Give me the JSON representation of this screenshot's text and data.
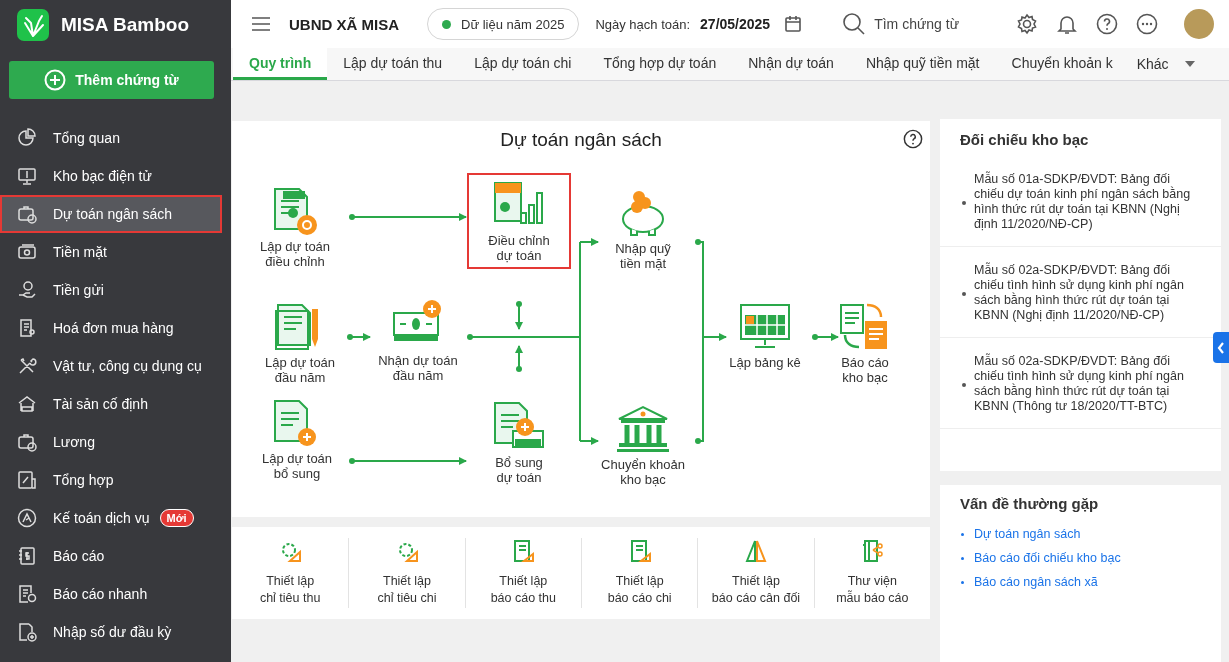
{
  "app": {
    "name": "MISA Bamboo"
  },
  "add_button": {
    "label": "Thêm chứng từ"
  },
  "sidebar": {
    "items": [
      {
        "label": "Tổng quan",
        "selected": false,
        "highlighted": false
      },
      {
        "label": "Kho bạc điện tử",
        "selected": false,
        "highlighted": false
      },
      {
        "label": "Dự toán ngân sách",
        "selected": true,
        "highlighted": true
      },
      {
        "label": "Tiền mặt",
        "selected": false,
        "highlighted": false
      },
      {
        "label": "Tiền gửi",
        "selected": false,
        "highlighted": false
      },
      {
        "label": "Hoá đơn mua hàng",
        "selected": false,
        "highlighted": false
      },
      {
        "label": "Vật tư, công cụ dụng cụ",
        "selected": false,
        "highlighted": false
      },
      {
        "label": "Tài sản cố định",
        "selected": false,
        "highlighted": false
      },
      {
        "label": "Lương",
        "selected": false,
        "highlighted": false
      },
      {
        "label": "Tổng hợp",
        "selected": false,
        "highlighted": false
      },
      {
        "label": "Kế toán dịch vụ",
        "selected": false,
        "highlighted": false,
        "badge": "Mới"
      },
      {
        "label": "Báo cáo",
        "selected": false,
        "highlighted": false
      },
      {
        "label": "Báo cáo nhanh",
        "selected": false,
        "highlighted": false
      },
      {
        "label": "Nhập số dư đầu kỳ",
        "selected": false,
        "highlighted": false
      }
    ]
  },
  "topbar": {
    "organization": "UBND XÃ MISA",
    "data_year": "Dữ liệu năm 2025",
    "date_label": "Ngày hạch toán:",
    "date": "27/05/2025",
    "search": {
      "placeholder": "Tìm chứng từ"
    }
  },
  "tabs": [
    {
      "label": "Quy trình",
      "selected": true
    },
    {
      "label": "Lập dự toán thu",
      "selected": false
    },
    {
      "label": "Lập dự toán chi",
      "selected": false
    },
    {
      "label": "Tổng hợp dự toán",
      "selected": false
    },
    {
      "label": "Nhận dự toán",
      "selected": false
    },
    {
      "label": "Nhập quỹ tiền mặt",
      "selected": false
    },
    {
      "label": "Chuyển khoản k",
      "selected": false
    }
  ],
  "more_tab": {
    "label": "Khác"
  },
  "diagram": {
    "title": "Dự toán ngân sách",
    "nodes": [
      {
        "label": "Lập dự toán\nđiều chỉnh",
        "highlighted": false
      },
      {
        "label": "Điều chỉnh\ndự toán",
        "highlighted": true
      },
      {
        "label": "Nhập quỹ\ntiền mặt",
        "highlighted": false
      },
      {
        "label": "Lập dự toán\nđầu năm",
        "highlighted": false
      },
      {
        "label": "Nhận dự toán\nđầu năm",
        "highlighted": false
      },
      {
        "label": "Lập bảng kê",
        "highlighted": false
      },
      {
        "label": "Báo cáo\nkho bạc",
        "highlighted": false
      },
      {
        "label": "Lập dự toán\nbổ sung",
        "highlighted": false
      },
      {
        "label": "Bổ sung\ndự toán",
        "highlighted": false
      },
      {
        "label": "Chuyển khoản\nkho bạc",
        "highlighted": false
      }
    ]
  },
  "settings": [
    {
      "label": "Thiết lập\nchỉ tiêu thu"
    },
    {
      "label": "Thiết lập\nchỉ tiêu chi"
    },
    {
      "label": "Thiết lập\nbáo cáo thu"
    },
    {
      "label": "Thiết lập\nbáo cáo chi"
    },
    {
      "label": "Thiết lập\nbáo cáo cân đối"
    },
    {
      "label": "Thư viện\nmẫu báo cáo"
    }
  ],
  "treasury_panel": {
    "title": "Đối chiếu kho bạc",
    "items": [
      "Mẫu số 01a-SDKP/ĐVDT: Bảng đối chiếu dự toán kinh phí ngân sách bằng hình thức rút dự toán tại KBNN (Nghị định 11/2020/NĐ-CP)",
      "Mẫu số 02a-SDKP/ĐVDT: Bảng đối chiếu tình hình sử dụng kinh phí ngân sách bằng hình thức rút dự toán tại KBNN (Nghị định 11/2020/NĐ-CP)",
      "Mẫu số 02a-SDKP/ĐVDT: Bảng đối chiếu tình hình sử dụng kinh phí ngân sách bằng hình thức rút dự toán tại KBNN (Thông tư 18/2020/TT-BTC)"
    ]
  },
  "faq_panel": {
    "title": "Vấn đề thường gặp",
    "links": [
      "Dự toán ngân sách",
      "Báo cáo đối chiếu kho bạc",
      "Báo cáo ngân sách xã"
    ]
  }
}
